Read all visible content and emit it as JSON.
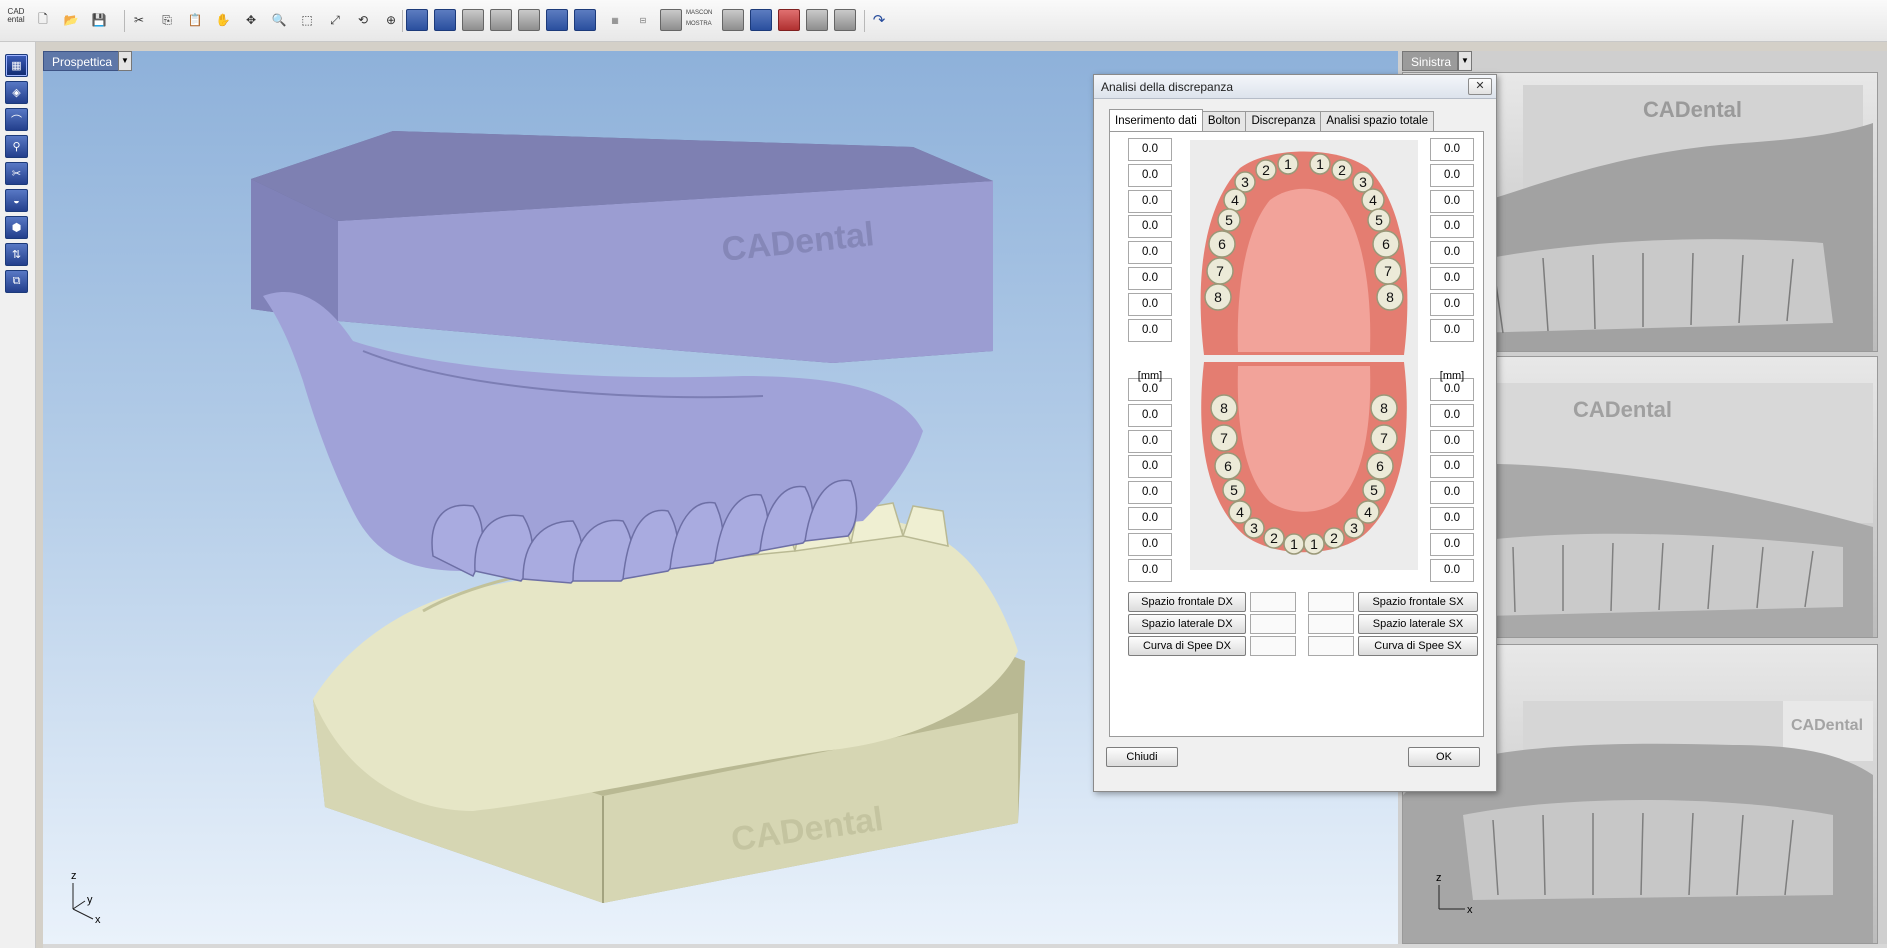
{
  "toolbar": {
    "logo_text": "CAD ental",
    "tools": [
      {
        "name": "new-file-icon",
        "glyph": "🗋"
      },
      {
        "name": "open-folder-icon",
        "glyph": "📂"
      },
      {
        "name": "save-icon",
        "glyph": "💾"
      },
      {
        "name": "cut-icon",
        "glyph": "✂"
      },
      {
        "name": "copy-icon",
        "glyph": "⎘"
      },
      {
        "name": "paste-icon",
        "glyph": "📋"
      },
      {
        "name": "pan-hand-icon",
        "glyph": "✋"
      },
      {
        "name": "move-icon",
        "glyph": "✥"
      },
      {
        "name": "zoom-icon",
        "glyph": "🔍"
      },
      {
        "name": "zoom-window-icon",
        "glyph": "⬚"
      },
      {
        "name": "zoom-fit-icon",
        "glyph": "⤢"
      },
      {
        "name": "rotate-icon",
        "glyph": "⟲"
      },
      {
        "name": "center-icon",
        "glyph": "⊕"
      }
    ],
    "small_labels": {
      "mascon": "MASCON",
      "mostra": "MOSTRA"
    }
  },
  "main_view": {
    "label": "Prospettica",
    "axes": {
      "z": "z",
      "y": "y",
      "x": "x"
    },
    "watermark_top": "CADental",
    "watermark_bottom": "CADental"
  },
  "side_views": {
    "label": "Sinistra",
    "watermarks": [
      "CADental",
      "CADental",
      "CADental"
    ],
    "axes": {
      "z": "z",
      "x": "x"
    }
  },
  "dialog": {
    "title": "Analisi della discrepanza",
    "close_glyph": "✕",
    "tabs": [
      "Inserimento dati",
      "Bolton",
      "Discrepanza",
      "Analisi spazio totale"
    ],
    "unit": "[mm]",
    "upper_right_values": [
      "0.0",
      "0.0",
      "0.0",
      "0.0",
      "0.0",
      "0.0",
      "0.0",
      "0.0"
    ],
    "upper_left_values": [
      "0.0",
      "0.0",
      "0.0",
      "0.0",
      "0.0",
      "0.0",
      "0.0",
      "0.0"
    ],
    "lower_right_values": [
      "0.0",
      "0.0",
      "0.0",
      "0.0",
      "0.0",
      "0.0",
      "0.0",
      "0.0"
    ],
    "lower_left_values": [
      "0.0",
      "0.0",
      "0.0",
      "0.0",
      "0.0",
      "0.0",
      "0.0",
      "0.0"
    ],
    "upper_teeth_right": [
      "1",
      "2",
      "3",
      "4",
      "5",
      "6",
      "7",
      "8"
    ],
    "upper_teeth_left": [
      "1",
      "2",
      "3",
      "4",
      "5",
      "6",
      "7",
      "8"
    ],
    "lower_teeth_right": [
      "1",
      "2",
      "3",
      "4",
      "5",
      "6",
      "7",
      "8"
    ],
    "lower_teeth_left": [
      "1",
      "2",
      "3",
      "4",
      "5",
      "6",
      "7",
      "8"
    ],
    "buttons_dx": [
      "Spazio frontale DX",
      "Spazio laterale DX",
      "Curva di Spee DX"
    ],
    "buttons_sx": [
      "Spazio frontale SX",
      "Spazio laterale SX",
      "Curva di Spee SX"
    ],
    "close_button": "Chiudi",
    "ok_button": "OK"
  },
  "colors": {
    "upper_model": "#9596c9",
    "lower_model": "#dcdcb8",
    "gum": "#e8877b",
    "tooth": "#ecead8",
    "viewport_top": "#8eb1da"
  }
}
